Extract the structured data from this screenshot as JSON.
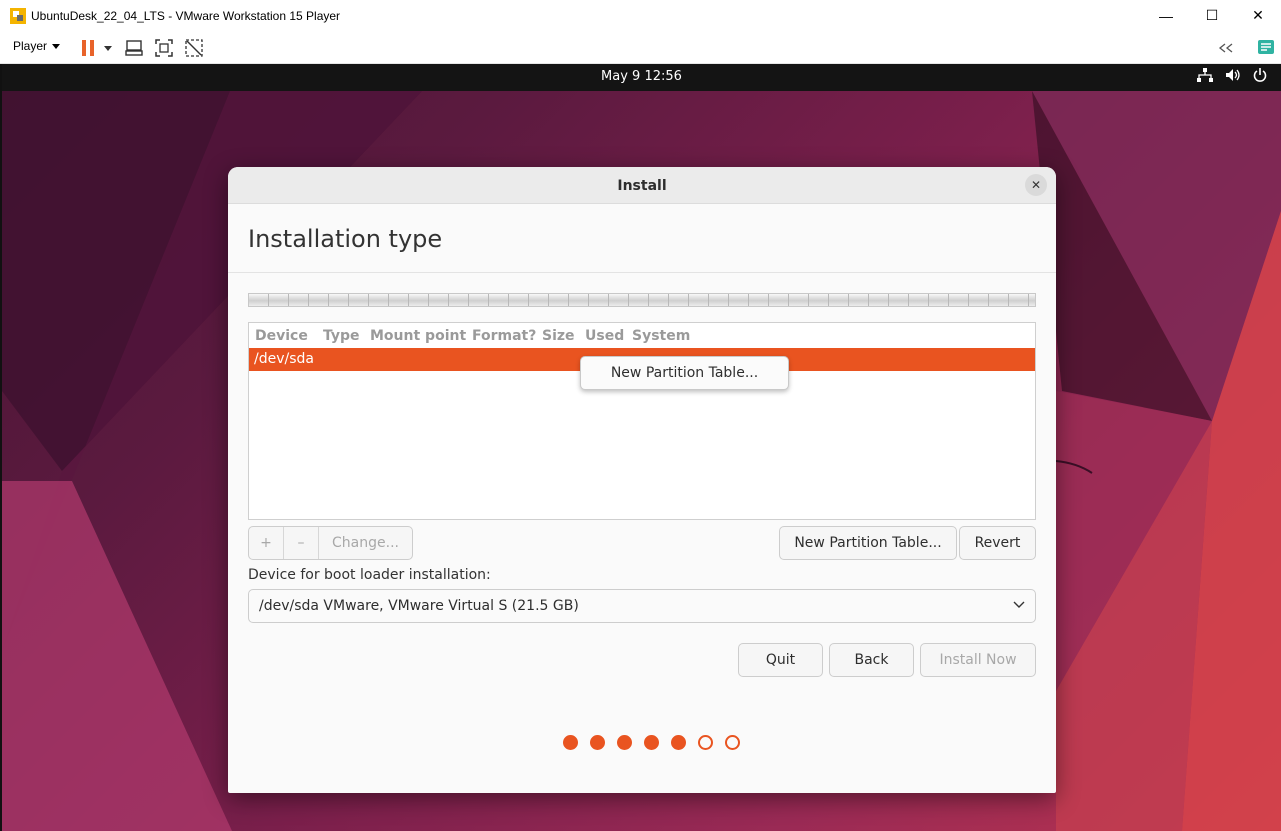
{
  "host_window": {
    "title": "UbuntuDesk_22_04_LTS - VMware Workstation 15 Player",
    "controls": {
      "minimize": "—",
      "maximize": "☐",
      "close": "✕"
    }
  },
  "host_toolbar": {
    "player_label": "Player",
    "icons": [
      "pause-icon",
      "dropdown-arrow-icon",
      "send-ctrl-alt-del-icon",
      "fullscreen-icon",
      "unity-icon",
      "collapse-toolbar-icon",
      "message-log-icon"
    ]
  },
  "guest_topbar": {
    "clock": "May 9  12:56",
    "tray_icons": [
      "network-icon",
      "volume-icon",
      "power-icon"
    ]
  },
  "dialog": {
    "title": "Install",
    "page_title": "Installation type",
    "partition_table": {
      "columns": [
        "Device",
        "Type",
        "Mount point",
        "Format?",
        "Size",
        "Used",
        "System"
      ],
      "rows": [
        {
          "device": "/dev/sda",
          "selected": true
        }
      ]
    },
    "context_popover": {
      "label": "New Partition Table..."
    },
    "buttons": {
      "add": "+",
      "remove": "–",
      "change": "Change...",
      "new_partition_table": "New Partition Table...",
      "revert": "Revert",
      "quit": "Quit",
      "back": "Back",
      "install_now": "Install Now"
    },
    "boot_loader": {
      "label": "Device for boot loader installation:",
      "selected": "/dev/sda VMware, VMware Virtual S (21.5 GB)"
    },
    "progress": {
      "total_steps": 7,
      "completed_steps": 5
    }
  },
  "colors": {
    "accent": "#e95420",
    "guest_bar": "#141414"
  }
}
